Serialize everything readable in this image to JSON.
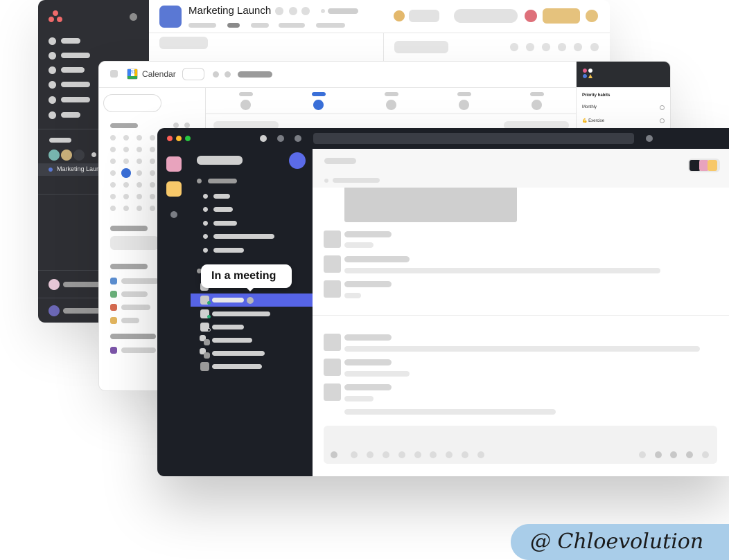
{
  "back_window": {
    "project_title": "Marketing Launch",
    "sidebar_project": "Marketing Launch",
    "colors": {
      "sidebar_bg": "#2e2f34",
      "project_icon": "#5a78d4",
      "logo": "#f06a6a"
    }
  },
  "calendar_window": {
    "app_name": "Calendar",
    "logo_text": "31",
    "right_panel": {
      "heading": "Priority habits",
      "items": [
        {
          "label": "Monthly"
        },
        {
          "label": "💪 Exercise"
        }
      ]
    }
  },
  "chat_window": {
    "tooltip": "In a meeting",
    "colors": {
      "sidebar_bg": "#1c1f26",
      "selected_row": "#5664e6",
      "avatar": "#5b6be8",
      "pink": "#e8a3bd",
      "yellow": "#f7c86a"
    }
  },
  "watermark": "@ Chloevolution"
}
